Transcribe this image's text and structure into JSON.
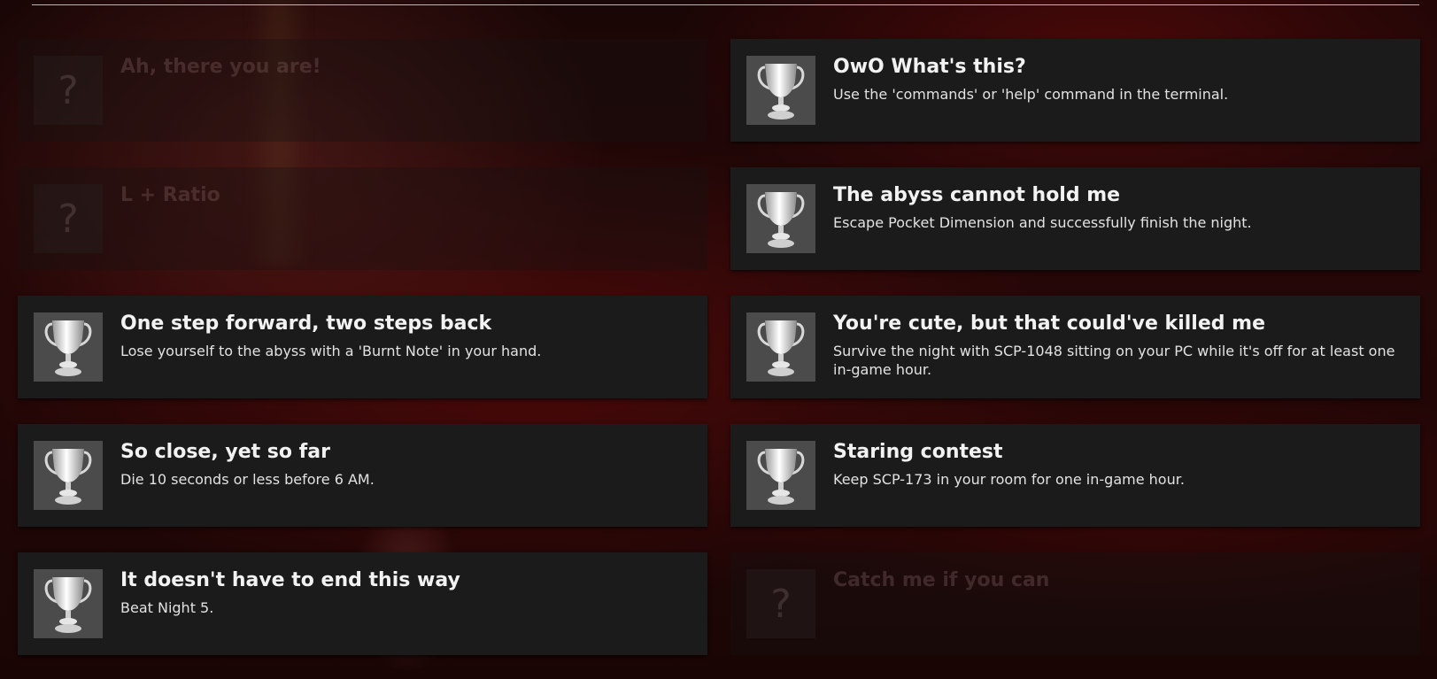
{
  "achievements": [
    {
      "title": "Ah, there you are!",
      "description": "",
      "unlocked": false,
      "icon": "question-mark-icon",
      "lock_glyph": "?"
    },
    {
      "title": "OwO What's this?",
      "description": "Use the 'commands' or 'help' command in the terminal.",
      "unlocked": true,
      "icon": "trophy-icon"
    },
    {
      "title": "L + Ratio",
      "description": "",
      "unlocked": false,
      "icon": "question-mark-icon",
      "lock_glyph": "?"
    },
    {
      "title": "The abyss cannot hold me",
      "description": "Escape Pocket Dimension and successfully finish the night.",
      "unlocked": true,
      "icon": "trophy-icon"
    },
    {
      "title": "One step forward, two steps back",
      "description": "Lose yourself to the abyss with a 'Burnt Note' in your hand.",
      "unlocked": true,
      "icon": "trophy-icon"
    },
    {
      "title": "You're cute, but that could've killed me",
      "description": "Survive the night with SCP-1048 sitting on your PC while it's off for at least one in-game hour.",
      "unlocked": true,
      "icon": "trophy-icon"
    },
    {
      "title": "So close, yet so far",
      "description": "Die 10 seconds or less before 6 AM.",
      "unlocked": true,
      "icon": "trophy-icon"
    },
    {
      "title": "Staring contest",
      "description": "Keep SCP-173 in your room for one in-game hour.",
      "unlocked": true,
      "icon": "trophy-icon"
    },
    {
      "title": "It doesn't have to end this way",
      "description": "Beat Night 5.",
      "unlocked": true,
      "icon": "trophy-icon"
    },
    {
      "title": "Catch me if you can",
      "description": "",
      "unlocked": false,
      "icon": "question-mark-icon",
      "lock_glyph": "?"
    }
  ],
  "colors": {
    "card_bg": "#1b1b1b",
    "icon_bg": "#4b4b4b",
    "title_text": "#f2f2f2",
    "desc_text": "#e2e2e2",
    "background_accent": "#2a0707"
  }
}
